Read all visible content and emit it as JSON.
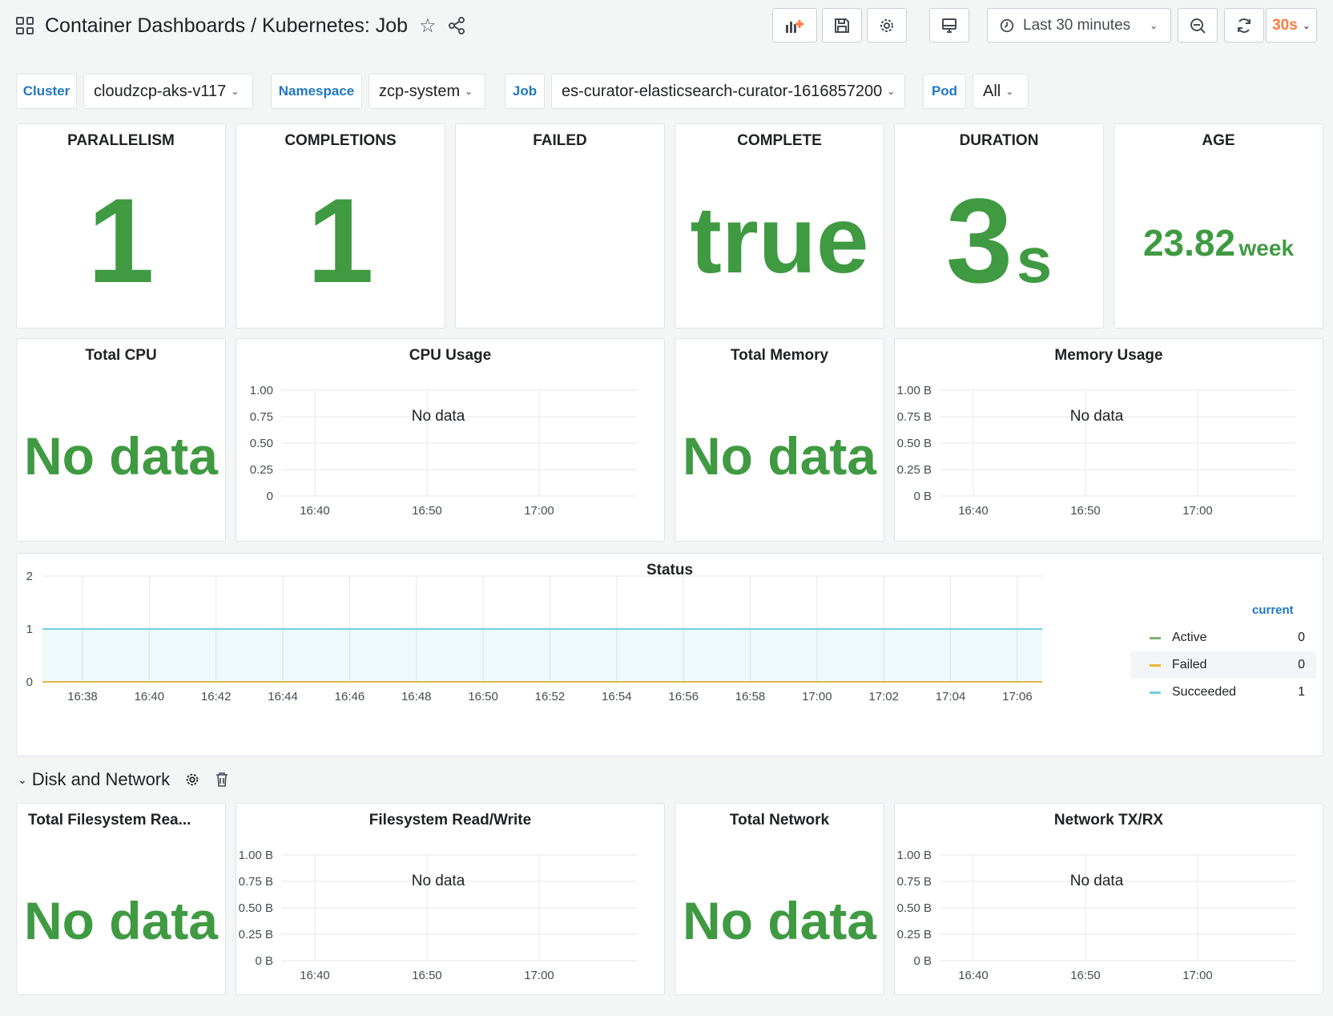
{
  "header": {
    "breadcrumb": "Container Dashboards / Kubernetes: Job",
    "time_range": "Last 30 minutes",
    "refresh": "30s",
    "accent": "#ff7941"
  },
  "variables": [
    {
      "label": "Cluster",
      "value": "cloudzcp-aks-v117"
    },
    {
      "label": "Namespace",
      "value": "zcp-system"
    },
    {
      "label": "Job",
      "value": "es-curator-elasticsearch-curator-1616857200"
    },
    {
      "label": "Pod",
      "value": "All"
    }
  ],
  "stats": {
    "parallelism": {
      "title": "PARALLELISM",
      "value": "1"
    },
    "completions": {
      "title": "COMPLETIONS",
      "value": "1"
    },
    "failed": {
      "title": "FAILED",
      "value": ""
    },
    "complete": {
      "title": "COMPLETE",
      "value": "true"
    },
    "duration": {
      "title": "DURATION",
      "value": "3",
      "unit": "s"
    },
    "age": {
      "title": "AGE",
      "value": "23.82",
      "unit": "week"
    },
    "total_cpu": {
      "title": "Total CPU",
      "value": "No data"
    },
    "total_memory": {
      "title": "Total Memory",
      "value": "No data"
    },
    "total_fs": {
      "title": "Total Filesystem Rea...",
      "value": "No data"
    },
    "total_network": {
      "title": "Total Network",
      "value": "No data"
    }
  },
  "graphs": {
    "cpu_usage": {
      "title": "CPU Usage",
      "no_data": "No data",
      "y_ticks": [
        "1.00",
        "0.75",
        "0.50",
        "0.25",
        "0"
      ],
      "x_ticks": [
        "16:40",
        "16:50",
        "17:00"
      ]
    },
    "memory_usage": {
      "title": "Memory Usage",
      "no_data": "No data",
      "y_ticks": [
        "1.00 B",
        "0.75 B",
        "0.50 B",
        "0.25 B",
        "0 B"
      ],
      "x_ticks": [
        "16:40",
        "16:50",
        "17:00"
      ]
    },
    "fs_rw": {
      "title": "Filesystem Read/Write",
      "no_data": "No data",
      "y_ticks": [
        "1.00 B",
        "0.75 B",
        "0.50 B",
        "0.25 B",
        "0 B"
      ],
      "x_ticks": [
        "16:40",
        "16:50",
        "17:00"
      ]
    },
    "network": {
      "title": "Network TX/RX",
      "no_data": "No data",
      "y_ticks": [
        "1.00 B",
        "0.75 B",
        "0.50 B",
        "0.25 B",
        "0 B"
      ],
      "x_ticks": [
        "16:40",
        "16:50",
        "17:00"
      ]
    }
  },
  "status_panel": {
    "title": "Status",
    "legend_header": "current",
    "legend": [
      {
        "name": "Active",
        "current": "0",
        "color": "#7eb26d"
      },
      {
        "name": "Failed",
        "current": "0",
        "color": "#eab839"
      },
      {
        "name": "Succeeded",
        "current": "1",
        "color": "#6ed0e0"
      }
    ]
  },
  "chart_data": {
    "type": "line",
    "title": "Status",
    "x": [
      "16:38",
      "16:40",
      "16:42",
      "16:44",
      "16:46",
      "16:48",
      "16:50",
      "16:52",
      "16:54",
      "16:56",
      "16:58",
      "17:00",
      "17:02",
      "17:04",
      "17:06"
    ],
    "y_ticks": [
      "0",
      "1",
      "2"
    ],
    "ylim": [
      0,
      2
    ],
    "series": [
      {
        "name": "Active",
        "values": [
          0,
          0,
          0,
          0,
          0,
          0,
          0,
          0,
          0,
          0,
          0,
          0,
          0,
          0,
          0
        ],
        "color": "#7eb26d"
      },
      {
        "name": "Failed",
        "values": [
          0,
          0,
          0,
          0,
          0,
          0,
          0,
          0,
          0,
          0,
          0,
          0,
          0,
          0,
          0
        ],
        "color": "#eab839"
      },
      {
        "name": "Succeeded",
        "values": [
          1,
          1,
          1,
          1,
          1,
          1,
          1,
          1,
          1,
          1,
          1,
          1,
          1,
          1,
          1
        ],
        "color": "#6ed0e0"
      }
    ],
    "grid": true,
    "legend_placement": "right"
  },
  "row": {
    "title": "Disk and Network"
  }
}
